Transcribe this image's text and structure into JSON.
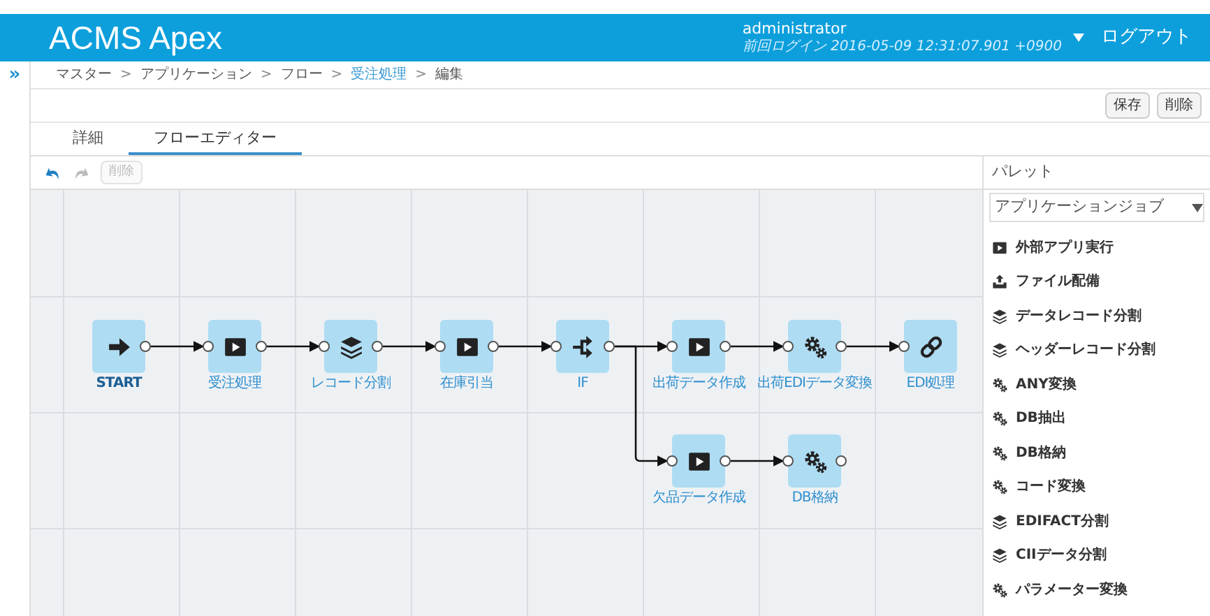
{
  "header": {
    "logo": "ACMS Apex",
    "user": "administrator",
    "last_login": "前回ログイン 2016-05-09 12:31:07.901 +0900",
    "logout": "ログアウト"
  },
  "sidebar_toggle": "»",
  "breadcrumb": [
    {
      "label": "マスター",
      "link": false
    },
    {
      "label": "アプリケーション",
      "link": false
    },
    {
      "label": "フロー",
      "link": false
    },
    {
      "label": "受注処理",
      "link": true
    },
    {
      "label": "編集",
      "link": false
    }
  ],
  "breadcrumb_separator": ">",
  "actions": [
    {
      "label": "保存"
    },
    {
      "label": "削除"
    }
  ],
  "tabs": [
    {
      "label": "詳細",
      "selected": false
    },
    {
      "label": "フローエディター",
      "selected": true
    }
  ],
  "toolbar": {
    "undo": {
      "disabled": false
    },
    "redo": {
      "disabled": true
    },
    "delete": {
      "label": "削除",
      "disabled": true
    }
  },
  "flow": {
    "nodes": [
      {
        "label": "START",
        "kind": "start",
        "input": false,
        "output": true
      },
      {
        "label": "受注処理",
        "kind": "app",
        "input": true,
        "output": true
      },
      {
        "label": "レコード分割",
        "kind": "layers",
        "input": true,
        "output": true
      },
      {
        "label": "在庫引当",
        "kind": "app",
        "input": true,
        "output": true
      },
      {
        "label": "IF",
        "kind": "branch",
        "input": true,
        "output": true,
        "branch": [
          {
            "label": "欠品データ作成",
            "kind": "app",
            "input": true,
            "output": true
          },
          {
            "label": "DB格納",
            "kind": "gears",
            "input": true,
            "output": true
          }
        ]
      },
      {
        "label": "出荷データ作成",
        "kind": "app",
        "input": true,
        "output": true
      },
      {
        "label": "出荷EDIデータ変換",
        "kind": "gears",
        "input": true,
        "output": true
      },
      {
        "label": "EDI処理",
        "kind": "link",
        "input": true,
        "output": false
      }
    ]
  },
  "palette": {
    "title": "パレット",
    "category": "アプリケーションジョブ",
    "items": [
      {
        "label": "外部アプリ実行",
        "kind": "app"
      },
      {
        "label": "ファイル配備",
        "kind": "deploy"
      },
      {
        "label": "データレコード分割",
        "kind": "layers"
      },
      {
        "label": "ヘッダーレコード分割",
        "kind": "layers"
      },
      {
        "label": "ANY変換",
        "kind": "gears"
      },
      {
        "label": "DB抽出",
        "kind": "gears"
      },
      {
        "label": "DB格納",
        "kind": "gears"
      },
      {
        "label": "コード変換",
        "kind": "gears"
      },
      {
        "label": "EDIFACT分割",
        "kind": "layers"
      },
      {
        "label": "CIIデータ分割",
        "kind": "layers"
      },
      {
        "label": "パラメーター変換",
        "kind": "gears"
      }
    ]
  }
}
